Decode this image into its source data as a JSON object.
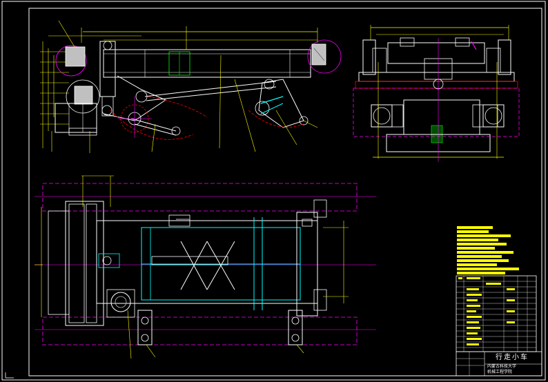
{
  "drawing": {
    "title": "行走小车",
    "subtitle_line1": "内蒙古科技大学",
    "subtitle_line2": "机械工程学院"
  },
  "colors": {
    "background": "#000000",
    "frame": "#ffffff",
    "outline": "#ffffff",
    "dimension": "#ffff00",
    "center_line": "#ff00ff",
    "hidden": "#ff0000",
    "cyan": "#00ffff",
    "green": "#00ff00",
    "blue": "#0000ff",
    "hatch": "#c0c0c0",
    "title_block_fill": "#ffff00"
  }
}
